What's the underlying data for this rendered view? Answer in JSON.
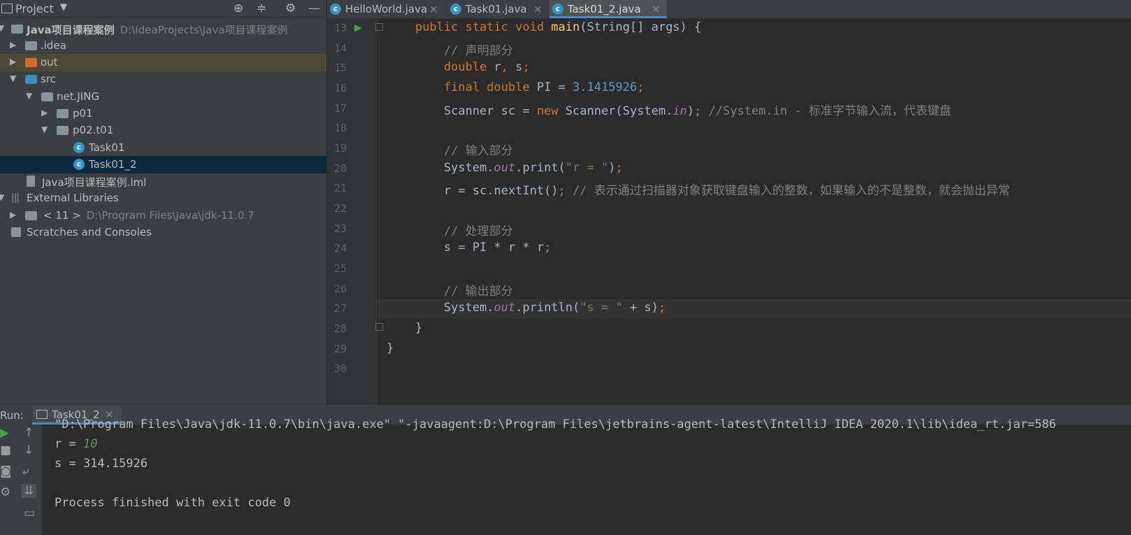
{
  "project": {
    "title": "Project",
    "tree": [
      {
        "label": "Java项目课程案例",
        "path": "D:\\IdeaProjects\\Java项目课程案例"
      },
      {
        "label": ".idea"
      },
      {
        "label": "out"
      },
      {
        "label": "src"
      },
      {
        "label": "net.JING"
      },
      {
        "label": "p01"
      },
      {
        "label": "p02.t01"
      },
      {
        "label": "Task01"
      },
      {
        "label": "Task01_2"
      },
      {
        "label": "Java项目课程案例.iml"
      },
      {
        "label": "External Libraries"
      },
      {
        "label": "< 11 >",
        "path": "D:\\Program Files\\Java\\jdk-11.0.7"
      },
      {
        "label": "Scratches and Consoles"
      }
    ]
  },
  "editor": {
    "tabs": [
      "HelloWorld.java",
      "Task01.java",
      "Task01_2.java"
    ],
    "close_glyph": "×",
    "line_numbers": [
      "13",
      "14",
      "15",
      "16",
      "17",
      "18",
      "19",
      "20",
      "21",
      "22",
      "23",
      "24",
      "25",
      "26",
      "27",
      "28",
      "29",
      "30"
    ]
  },
  "run": {
    "label": "Run:",
    "tab": "Task01_2",
    "output": [
      "\"D:\\Program Files\\Java\\jdk-11.0.7\\bin\\java.exe\" \"-javaagent:D:\\Program Files\\jetbrains-agent-latest\\IntelliJ IDEA 2020.1\\lib\\idea_rt.jar=586",
      "r = ",
      "10",
      "s = 314.15926",
      "Process finished with exit code 0"
    ]
  },
  "colors": {
    "keyword": "#cc7832",
    "string": "#6a8759",
    "number": "#6897bb",
    "comment": "#808080",
    "field": "#9876aa",
    "function": "#ffc66d"
  }
}
